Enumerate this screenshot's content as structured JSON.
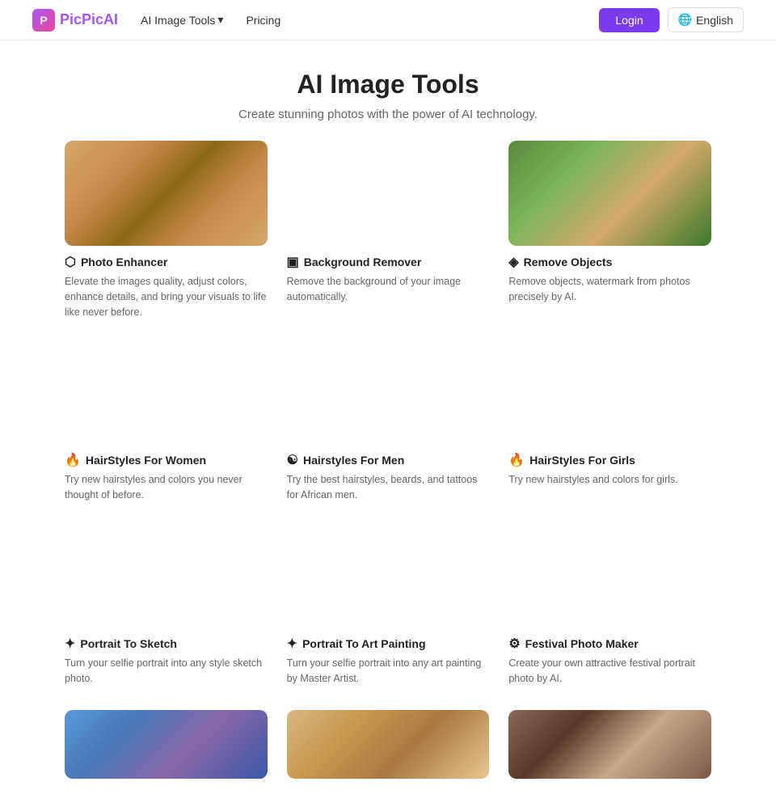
{
  "nav": {
    "logo_letter": "P",
    "logo_name_1": "PicPic",
    "logo_name_2": "AI",
    "tools_label": "AI Image Tools",
    "tools_arrow": "▾",
    "pricing_label": "Pricing",
    "login_label": "Login",
    "lang_icon": "🌐",
    "lang_label": "English"
  },
  "hero": {
    "title": "AI Image Tools",
    "subtitle": "Create stunning photos with the power of AI technology."
  },
  "tools": [
    {
      "id": "photo-enhancer",
      "icon": "⬡",
      "title": "Photo Enhancer",
      "desc": "Elevate the images quality, adjust colors, enhance details, and bring your visuals to life like never before.",
      "img_class": "img-photo-enhancer"
    },
    {
      "id": "background-remover",
      "icon": "▣",
      "title": "Background Remover",
      "desc": "Remove the background of your image automatically.",
      "img_class": "img-bg-remover split"
    },
    {
      "id": "remove-objects",
      "icon": "◈",
      "title": "Remove Objects",
      "desc": "Remove objects, watermark from photos precisely by AI.",
      "img_class": "img-remove-objects"
    },
    {
      "id": "hairstyles-women",
      "icon": "🔥",
      "title": "HairStyles For Women",
      "desc": "Try new hairstyles and colors you never thought of before.",
      "img_class": "img-hairstyles-women split"
    },
    {
      "id": "hairstyles-men",
      "icon": "☯",
      "title": "Hairstyles For Men",
      "desc": "Try the best hairstyles, beards, and tattoos for African men.",
      "img_class": "img-hairstyles-men split"
    },
    {
      "id": "hairstyles-girls",
      "icon": "🔥",
      "title": "HairStyles For Girls",
      "desc": "Try new hairstyles and colors for girls.",
      "img_class": "img-hairstyles-girls split"
    },
    {
      "id": "portrait-sketch",
      "icon": "✦",
      "title": "Portrait To Sketch",
      "desc": "Turn your selfie portrait into any style sketch photo.",
      "img_class": "img-portrait-sketch split"
    },
    {
      "id": "portrait-art",
      "icon": "✦",
      "title": "Portrait To Art Painting",
      "desc": "Turn your selfie portrait into any art painting by Master Artist.",
      "img_class": "img-portrait-art split"
    },
    {
      "id": "festival",
      "icon": "⚙",
      "title": "Festival Photo Maker",
      "desc": "Create your own attractive festival portrait photo by AI.",
      "img_class": "img-festival split"
    }
  ],
  "bottom_row": [
    {
      "id": "bottom-1",
      "img_class": "img-bottom-1"
    },
    {
      "id": "bottom-2",
      "img_class": "img-bottom-2"
    },
    {
      "id": "bottom-3",
      "img_class": "img-bottom-3"
    }
  ]
}
